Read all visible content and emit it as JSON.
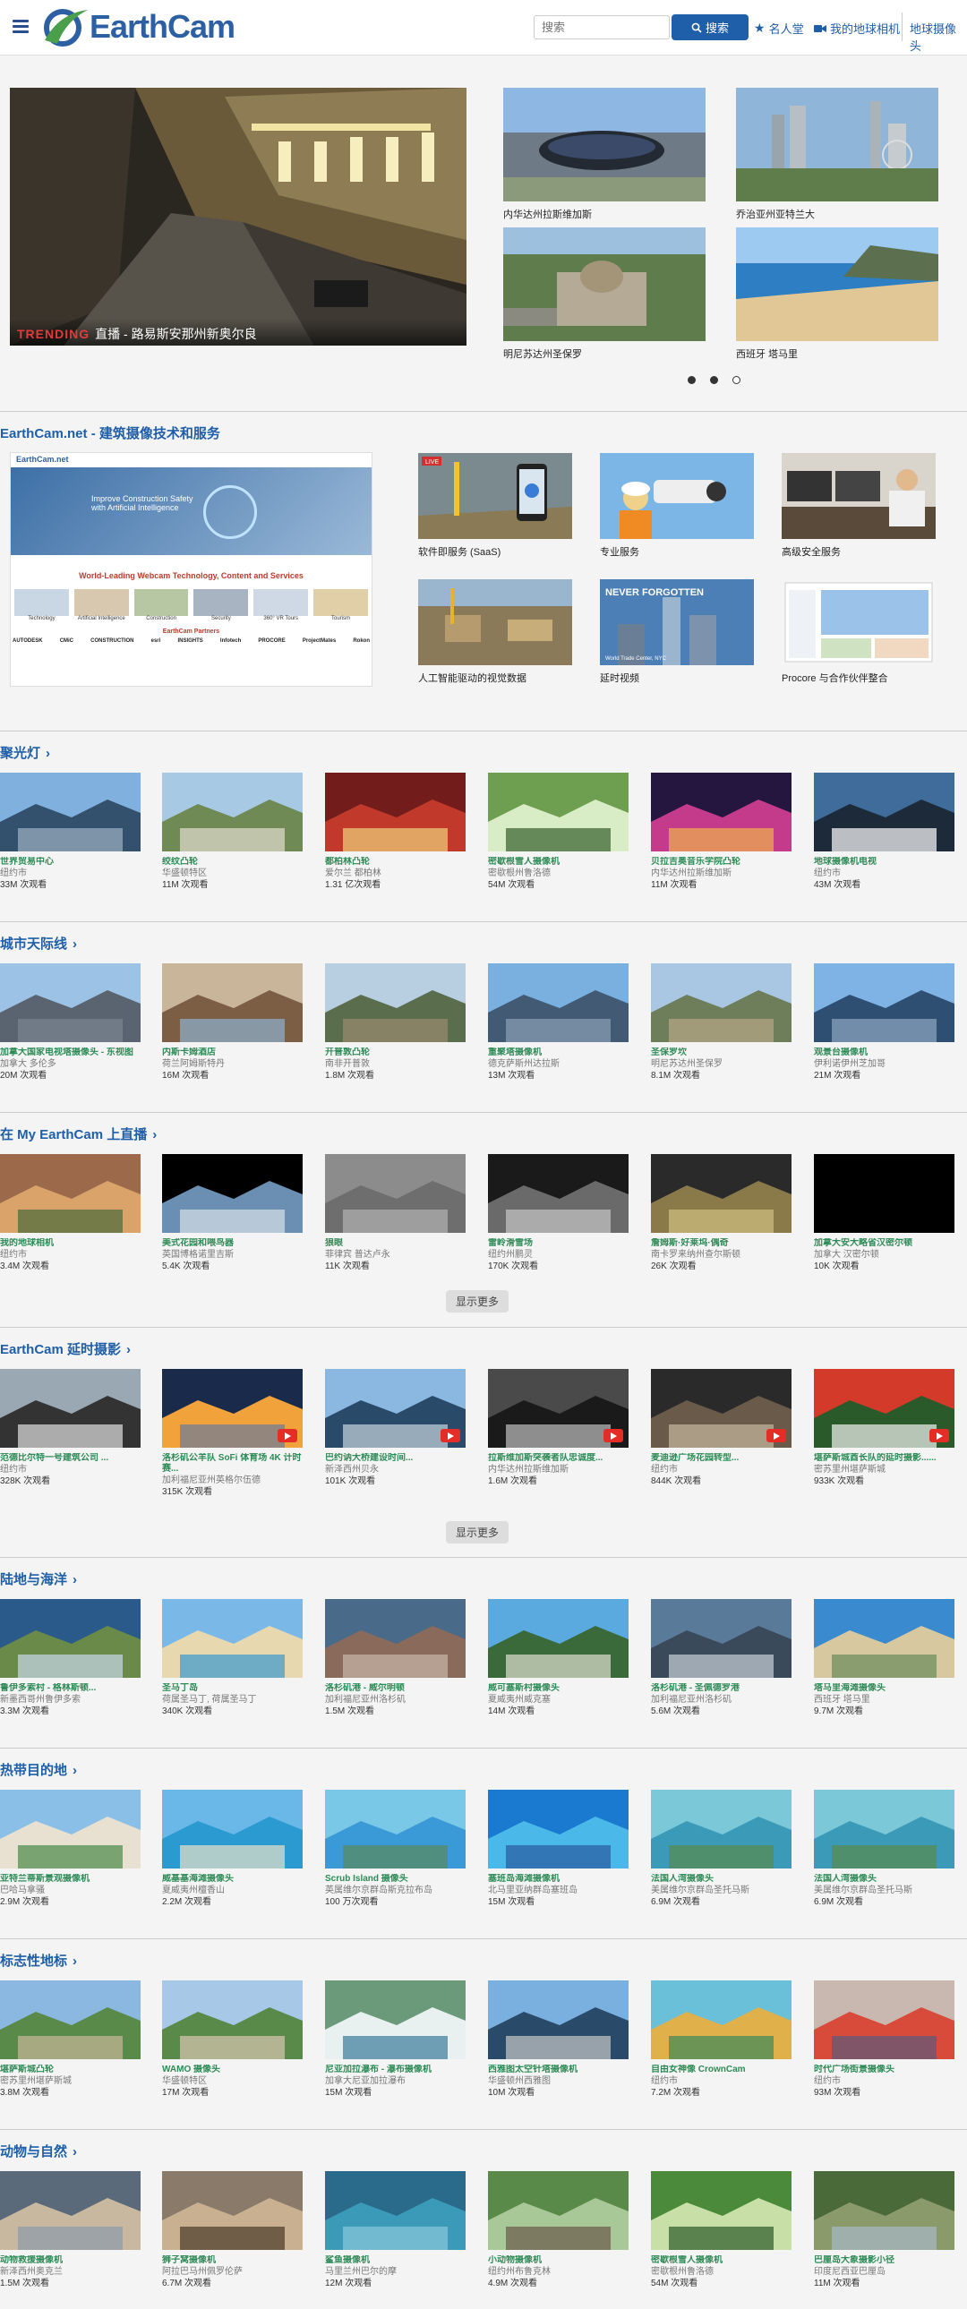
{
  "header": {
    "logo": "EarthCam",
    "search_placeholder": "搜索",
    "search_button": "搜索",
    "nav": [
      "名人堂",
      "我的地球相机",
      "地球摄像头"
    ]
  },
  "hero": {
    "badge": "TRENDING",
    "caption": "直播 - 路易斯安那州新奥尔良"
  },
  "featured": [
    "内华达州拉斯维加斯",
    "乔治亚州亚特兰大",
    "明尼苏达州圣保罗",
    "西班牙 塔马里"
  ],
  "tech": {
    "title": "EarthCam.net - 建筑摄像技术和服务",
    "screenshot": {
      "brand": "EarthCam.net",
      "headline": "Improve Construction Safety with Artificial Intelligence",
      "tagline": "World-Leading Webcam Technology, Content and Services",
      "boxes": [
        "Technology",
        "Artificial Intelligence",
        "Construction",
        "Security",
        "360° VR Tours",
        "Tourism"
      ],
      "partners": "EarthCam Partners",
      "partner_logos": [
        "AUTODESK",
        "CMiC",
        "CONSTRUCTION",
        "esri",
        "INSIGHTS",
        "Infotech",
        "PROCORE",
        "ProjectMates",
        "Rokon"
      ]
    },
    "services": [
      "软件即服务 (SaaS)",
      "专业服务",
      "高级安全服务",
      "人工智能驱动的视觉数据",
      "延时视频",
      "Procore 与合作伙伴整合"
    ],
    "live_badge": "LIVE",
    "nf_title": "NEVER FORGOTTEN",
    "nf_sub": "World Trade Center, NYC"
  },
  "sections": [
    {
      "title": "聚光灯",
      "items": [
        {
          "n": "世界贸易中心",
          "l": "纽约市",
          "v": "33M 次观看"
        },
        {
          "n": "绞纹凸轮",
          "l": "华盛顿特区",
          "v": "11M 次观看"
        },
        {
          "n": "都柏林凸轮",
          "l": "爱尔兰 都柏林",
          "v": "1.31 亿次观看"
        },
        {
          "n": "密歇根雪人摄像机",
          "l": "密歇根州鲁洛德",
          "v": "54M 次观看"
        },
        {
          "n": "贝拉吉奥音乐学院凸轮",
          "l": "内华达州拉斯维加斯",
          "v": "11M 次观看"
        },
        {
          "n": "地球摄像机电视",
          "l": "纽约市",
          "v": "43M 次观看"
        }
      ]
    },
    {
      "title": "城市天际线",
      "items": [
        {
          "n": "加拿大国家电视塔摄像头 - 东视图",
          "l": "加拿大 多伦多",
          "v": "20M 次观看"
        },
        {
          "n": "内斯卡姆酒店",
          "l": "荷兰阿姆斯特丹",
          "v": "16M 次观看"
        },
        {
          "n": "开普敦凸轮",
          "l": "南非开普敦",
          "v": "1.8M 次观看"
        },
        {
          "n": "重聚塔摄像机",
          "l": "德克萨斯州达拉斯",
          "v": "13M 次观看"
        },
        {
          "n": "圣保罗坎",
          "l": "明尼苏达州圣保罗",
          "v": "8.1M 次观看"
        },
        {
          "n": "观景台摄像机",
          "l": "伊利诺伊州芝加哥",
          "v": "21M 次观看"
        }
      ]
    },
    {
      "title": "在 My EarthCam 上直播",
      "items": [
        {
          "n": "我的地球相机",
          "l": "纽约市",
          "v": "3.4M 次观看"
        },
        {
          "n": "美式花园和喂鸟器",
          "l": "英国博格诺里吉斯",
          "v": "5.4K 次观看"
        },
        {
          "n": "狼眼",
          "l": "菲律宾 普达卢永",
          "v": "11K 次观看"
        },
        {
          "n": "雷岭滑雪场",
          "l": "纽约州鹏灵",
          "v": "170K 次观看"
        },
        {
          "n": "詹姆斯·好莱坞·偶奇",
          "l": "南卡罗来纳州查尔斯顿",
          "v": "26K 次观看"
        },
        {
          "n": "加拿大安大略省汉密尔顿",
          "l": "加拿大 汉密尔顿",
          "v": "10K 次观看"
        }
      ],
      "more": "显示更多"
    },
    {
      "title": "EarthCam 延时摄影",
      "items": [
        {
          "n": "范德比尔特一号建筑公司 ...",
          "l": "纽约市",
          "v": "328K 次观看"
        },
        {
          "n": "洛杉矶公羊队 SoFi 体育场 4K 计时赛...",
          "l": "加利福尼亚州英格尔伍德",
          "v": "315K 次观看"
        },
        {
          "n": "巴约讷大桥建设时间...",
          "l": "新泽西州贝永",
          "v": "101K 次观看"
        },
        {
          "n": "拉斯维加斯突袭者队忠诚度...",
          "l": "内华达州拉斯维加斯",
          "v": "1.6M 次观看"
        },
        {
          "n": "麦迪逊广场花园转型...",
          "l": "纽约市",
          "v": "844K 次观看"
        },
        {
          "n": "堪萨斯城酋长队的延时摄影......",
          "l": "密苏里州堪萨斯城",
          "v": "933K 次观看"
        }
      ],
      "more": "显示更多"
    },
    {
      "title": "陆地与海洋",
      "items": [
        {
          "n": "鲁伊多索村 - 格林斯顿...",
          "l": "新墨西哥州鲁伊多索",
          "v": "3.3M 次观看"
        },
        {
          "n": "圣马丁岛",
          "l": "荷属圣马丁, 荷属圣马丁",
          "v": "340K 次观看"
        },
        {
          "n": "洛杉矶港 - 威尔明顿",
          "l": "加利福尼亚州洛杉矶",
          "v": "1.5M 次观看"
        },
        {
          "n": "威可塞斯村摄像头",
          "l": "夏威夷州威克塞",
          "v": "14M 次观看"
        },
        {
          "n": "洛杉矶港 - 圣佩德罗港",
          "l": "加利福尼亚州洛杉矶",
          "v": "5.6M 次观看"
        },
        {
          "n": "塔马里海滩摄像头",
          "l": "西班牙 塔马里",
          "v": "9.7M 次观看"
        }
      ]
    },
    {
      "title": "热带目的地",
      "items": [
        {
          "n": "亚特兰蒂斯景观摄像机",
          "l": "巴哈马拿骚",
          "v": "2.9M 次观看"
        },
        {
          "n": "威基基海滩摄像头",
          "l": "夏威夷州檀香山",
          "v": "2.2M 次观看"
        },
        {
          "n": "Scrub Island 摄像头",
          "l": "英属维尔京群岛斯克拉布岛",
          "v": "100 万次观看"
        },
        {
          "n": "塞班岛海滩摄像机",
          "l": "北马里亚纳群岛塞班岛",
          "v": "15M 次观看"
        },
        {
          "n": "法国人湾摄像头",
          "l": "美属维尔京群岛圣托马斯",
          "v": "6.9M 次观看"
        },
        {
          "n": "法国人湾摄像头",
          "l": "美属维尔京群岛圣托马斯",
          "v": "6.9M 次观看"
        }
      ]
    },
    {
      "title": "标志性地标",
      "items": [
        {
          "n": "堪萨斯城凸轮",
          "l": "密苏里州堪萨斯城",
          "v": "3.8M 次观看"
        },
        {
          "n": "WAMO 摄像头",
          "l": "华盛顿特区",
          "v": "17M 次观看"
        },
        {
          "n": "尼亚加拉瀑布 - 瀑布摄像机",
          "l": "加拿大尼亚加拉瀑布",
          "v": "15M 次观看"
        },
        {
          "n": "西雅图太空针塔摄像机",
          "l": "华盛顿州西雅图",
          "v": "10M 次观看"
        },
        {
          "n": "自由女神像 CrownCam",
          "l": "纽约市",
          "v": "7.2M 次观看"
        },
        {
          "n": "时代广场街景摄像头",
          "l": "纽约市",
          "v": "93M 次观看"
        }
      ]
    },
    {
      "title": "动物与自然",
      "items": [
        {
          "n": "动物救援摄像机",
          "l": "新泽西州奥克兰",
          "v": "1.5M 次观看"
        },
        {
          "n": "狮子窝摄像机",
          "l": "阿拉巴马州佩罗伦萨",
          "v": "6.7M 次观看"
        },
        {
          "n": "鲨鱼摄像机",
          "l": "马里兰州巴尔的摩",
          "v": "12M 次观看"
        },
        {
          "n": "小动物摄像机",
          "l": "纽约州布鲁克林",
          "v": "4.9M 次观看"
        },
        {
          "n": "密歇根雪人摄像机",
          "l": "密歇根州鲁洛德",
          "v": "54M 次观看"
        },
        {
          "n": "巴厘岛大象摄影小径",
          "l": "印度尼西亚巴厘岛",
          "v": "11M 次观看"
        }
      ]
    }
  ]
}
